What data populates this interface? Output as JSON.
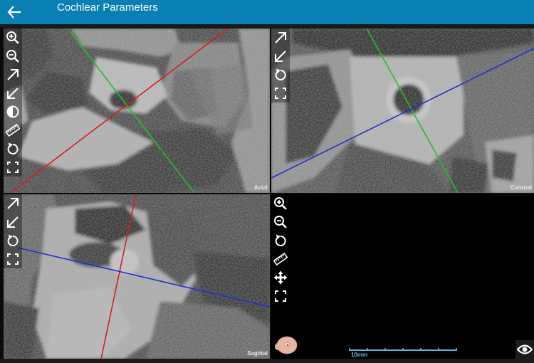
{
  "header": {
    "title": "Cochlear Parameters",
    "back_icon": "arrow-left-icon",
    "color": "#0a7fb3"
  },
  "viewports": {
    "axial": {
      "label": "Axial",
      "tools": [
        "zoom-in-icon",
        "zoom-out-icon",
        "arrow-up-right-icon",
        "arrow-down-left-icon",
        "contrast-icon",
        "ruler-icon",
        "rotate-icon",
        "fullscreen-icon"
      ]
    },
    "coronal": {
      "label": "Coronal",
      "tools": [
        "arrow-up-right-icon",
        "arrow-down-left-icon",
        "rotate-icon",
        "fullscreen-icon"
      ]
    },
    "sagittal": {
      "label": "Sagittal",
      "tools": [
        "arrow-up-right-icon",
        "arrow-down-left-icon",
        "rotate-icon",
        "fullscreen-icon"
      ]
    },
    "volume3d": {
      "tools": [
        "zoom-in-icon",
        "zoom-out-icon",
        "rotate-icon",
        "ruler-icon",
        "move-icon",
        "fullscreen-icon"
      ],
      "scale_label": "10mm",
      "orientation_icon": "head-orientation-icon",
      "visibility_icon": "eye-icon"
    }
  },
  "colors": {
    "axis_red": "#d42020",
    "axis_green": "#22c022",
    "axis_blue": "#2030d0",
    "scale_bar": "#5fb6e6"
  }
}
